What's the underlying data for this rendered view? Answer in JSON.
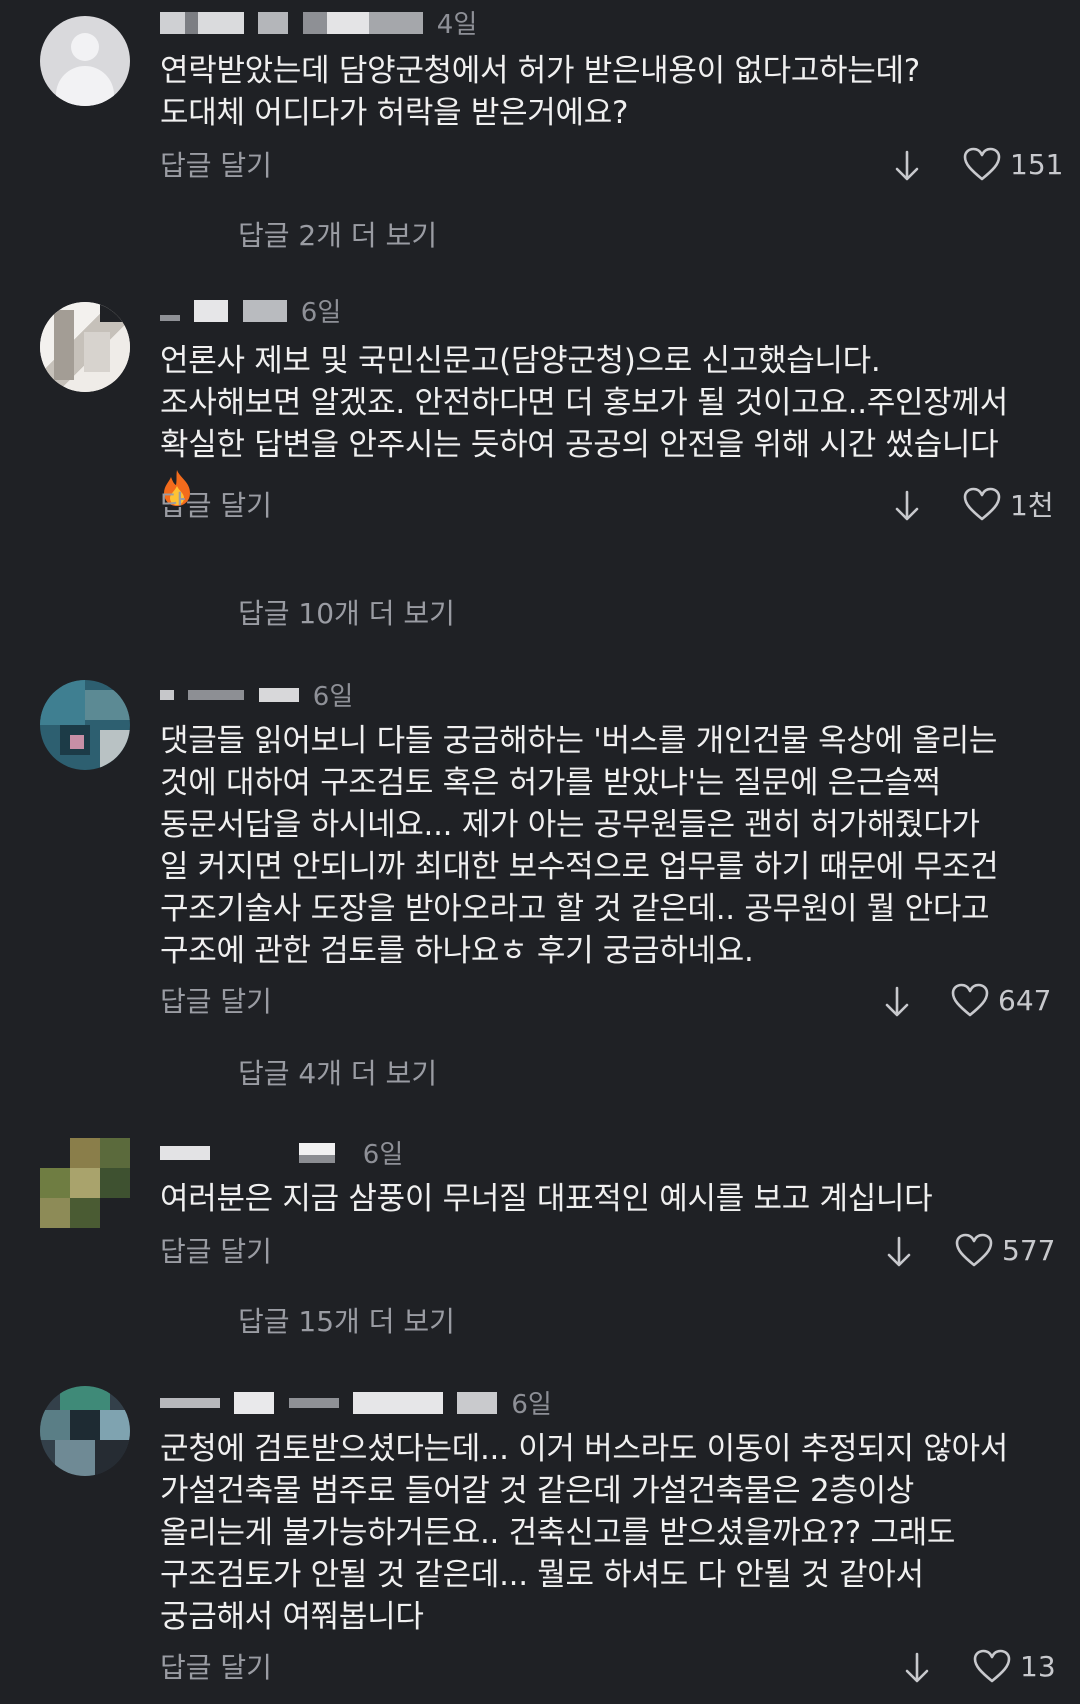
{
  "comments": [
    {
      "time": "4일",
      "lines": [
        "연락받았는데 담양군청에서 허가 받은내용이 없다고하는데?",
        "도대체 어디다가 허락을 받은거에요?"
      ],
      "reply_label": "답글 달기",
      "likes": "151",
      "more_replies": "답글 2개 더 보기"
    },
    {
      "time": "6일",
      "lines": [
        "언론사 제보 및 국민신문고(담양군청)으로 신고했습니다.",
        "조사해보면 알겠죠. 안전하다면 더 홍보가 될 것이고요..주인장께서",
        "확실한 답변을 안주시는 듯하여 공공의 안전을 위해 시간 썼습니다"
      ],
      "emoji": "fire-icon",
      "reply_label": "답글 달기",
      "likes": "1천",
      "more_replies": "답글 10개 더 보기"
    },
    {
      "time": "6일",
      "lines": [
        "댓글들 읽어보니 다들 궁금해하는 '버스를 개인건물 옥상에 올리는",
        "것에 대하여 구조검토 혹은 허가를 받았냐'는 질문에 은근슬쩍",
        "동문서답을 하시네요... 제가 아는 공무원들은 괜히 허가해줬다가",
        "일 커지면 안되니까 최대한 보수적으로 업무를 하기 때문에 무조건",
        "구조기술사 도장을 받아오라고 할 것 같은데.. 공무원이 뭘 안다고",
        "구조에 관한 검토를 하나요ㅎ 후기 궁금하네요."
      ],
      "reply_label": "답글 달기",
      "likes": "647",
      "more_replies": "답글 4개 더 보기"
    },
    {
      "time": "6일",
      "lines": [
        "여러분은 지금 삼풍이 무너질 대표적인 예시를 보고 계십니다"
      ],
      "reply_label": "답글 달기",
      "likes": "577",
      "more_replies": "답글 15개 더 보기"
    },
    {
      "time": "6일",
      "lines": [
        "군청에 검토받으셨다는데... 이거 버스라도 이동이 추정되지 않아서",
        "가설건축물 범주로 들어갈 것 같은데 가설건축물은 2층이상",
        "올리는게 불가능하거든요.. 건축신고를 받으셨을까요?? 그래도",
        "구조검토가 안될 것 같은데... 뭘로 하셔도 다 안될 것 같아서",
        "궁금해서 여쭤봅니다"
      ],
      "reply_label": "답글 달기",
      "likes": "13"
    }
  ],
  "colors": {
    "background": "#1f2125",
    "text": "#f0f0f0",
    "muted": "#9a9ca3"
  }
}
